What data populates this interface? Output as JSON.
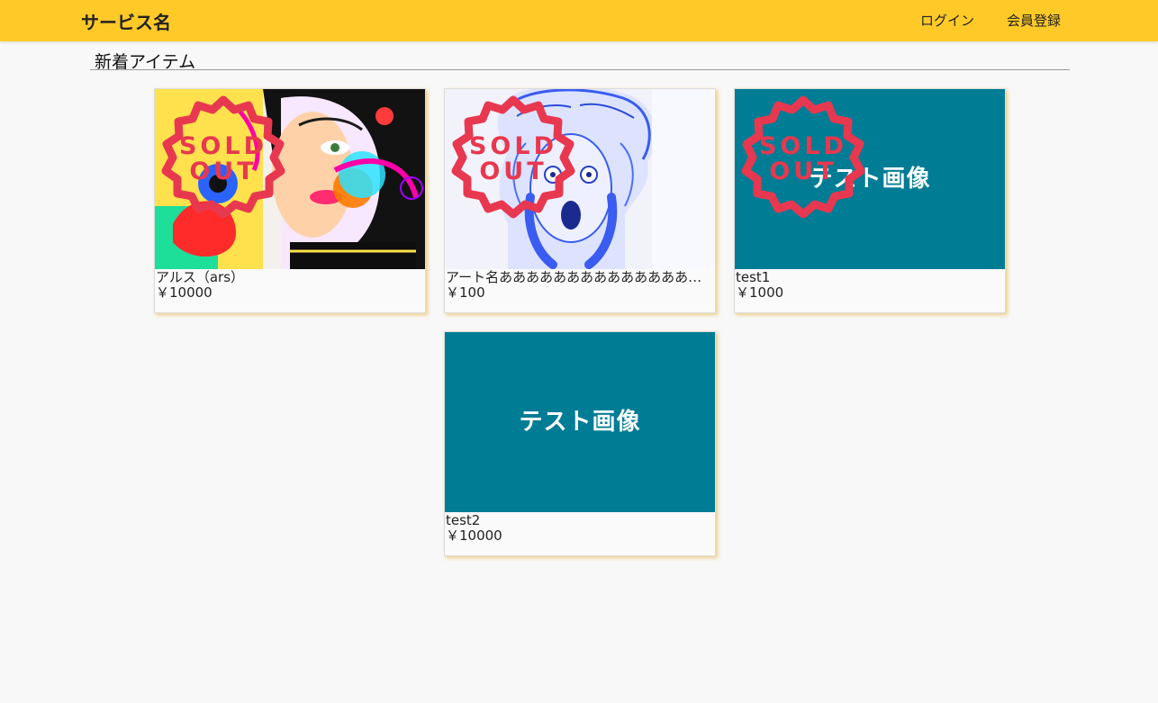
{
  "header": {
    "brand": "サービス名",
    "login_label": "ログイン",
    "register_label": "会員登録",
    "accent_color": "#ffca28"
  },
  "section": {
    "title": "新着アイテム"
  },
  "items": [
    {
      "name": "アルス（ars）",
      "price": "￥10000",
      "image": "colorful-abstract-portrait",
      "sold_out": true
    },
    {
      "name": "アート名ああああああああああああああああああああ",
      "price": "￥100",
      "image": "blue-sketch-screaming-man",
      "sold_out": true
    },
    {
      "name": "test1",
      "price": "￥1000",
      "image": "test-image-placeholder",
      "sold_out": true
    },
    {
      "name": "test2",
      "price": "￥10000",
      "image": "test-image-placeholder",
      "sold_out": false
    }
  ],
  "placeholder": {
    "text": "テスト画像",
    "bg_color": "#017c95"
  },
  "badge": {
    "line1": "SOLD",
    "line2": "OUT",
    "color": "#e8384f"
  }
}
